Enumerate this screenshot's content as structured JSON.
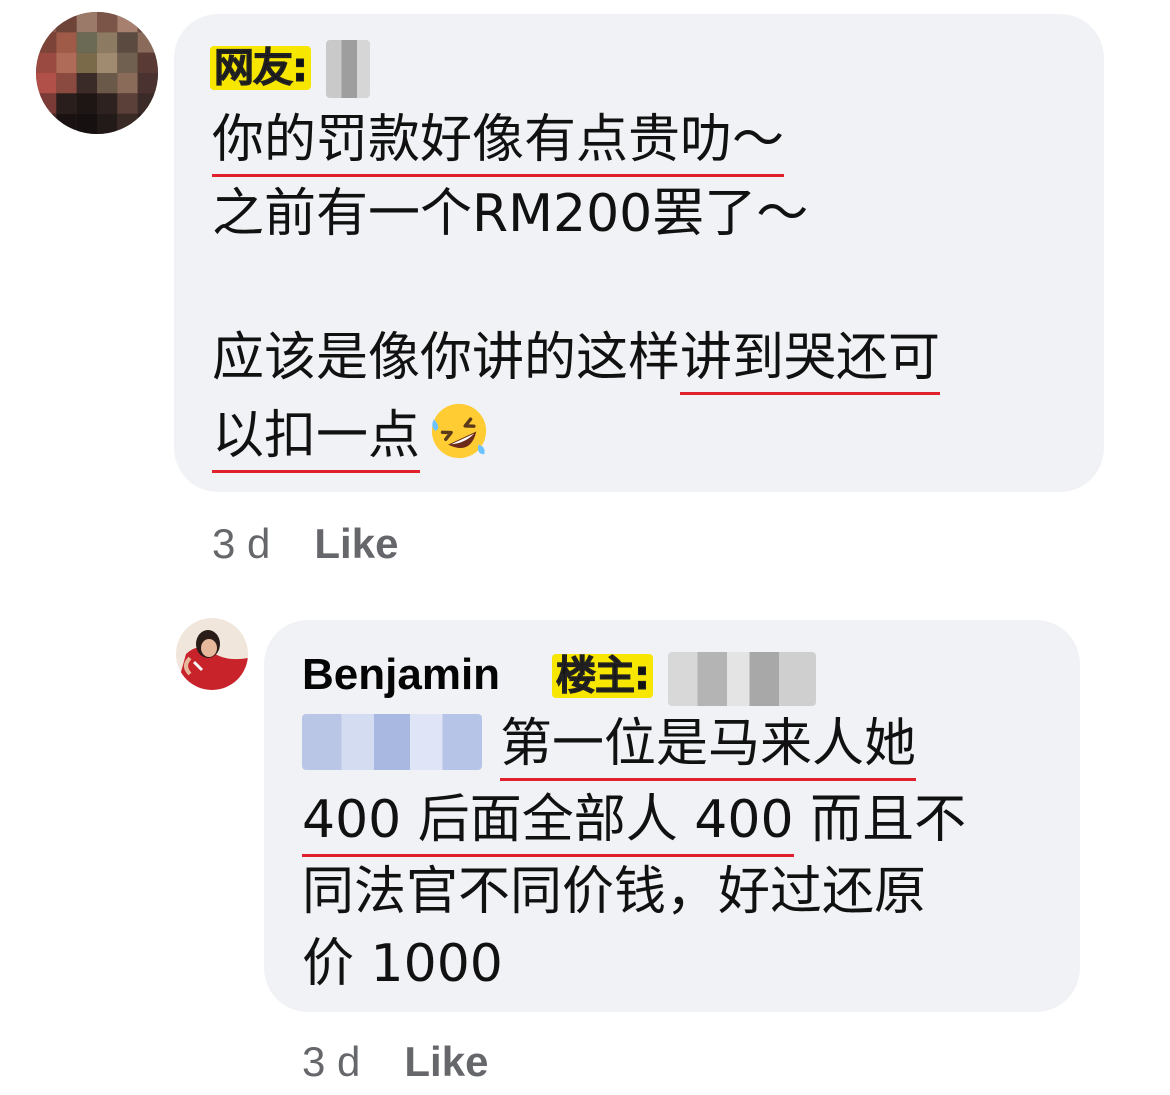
{
  "comment1": {
    "tag_label": "网友:",
    "lines": [
      "你的罚款好像有点贵叻～",
      "之前有一个RM200罢了～",
      "应该是像你讲的这样讲到哭还可",
      "以扣一点"
    ],
    "line3_prefix": "应该是像你讲的这样",
    "line3_underlined": "讲到哭还可",
    "line4_text": "以扣一点",
    "emoji_icon": "rofl-emoji-icon",
    "time": "3 d",
    "like_label": "Like"
  },
  "comment2": {
    "author": "Benjamin",
    "tag_label": "楼主:",
    "line1_text": "第一位是马来人她",
    "line2_underlined": "400 后面全部人 400",
    "line2_rest": "而且不",
    "line3_text": "同法官不同价钱，好过还原",
    "line4_text": "价 1000",
    "time": "3 d",
    "like_label": "Like"
  },
  "colors": {
    "bubble": "#f0f2f5",
    "tag": "#f7e600",
    "underline": "#e0202a",
    "meta": "#65676b"
  }
}
